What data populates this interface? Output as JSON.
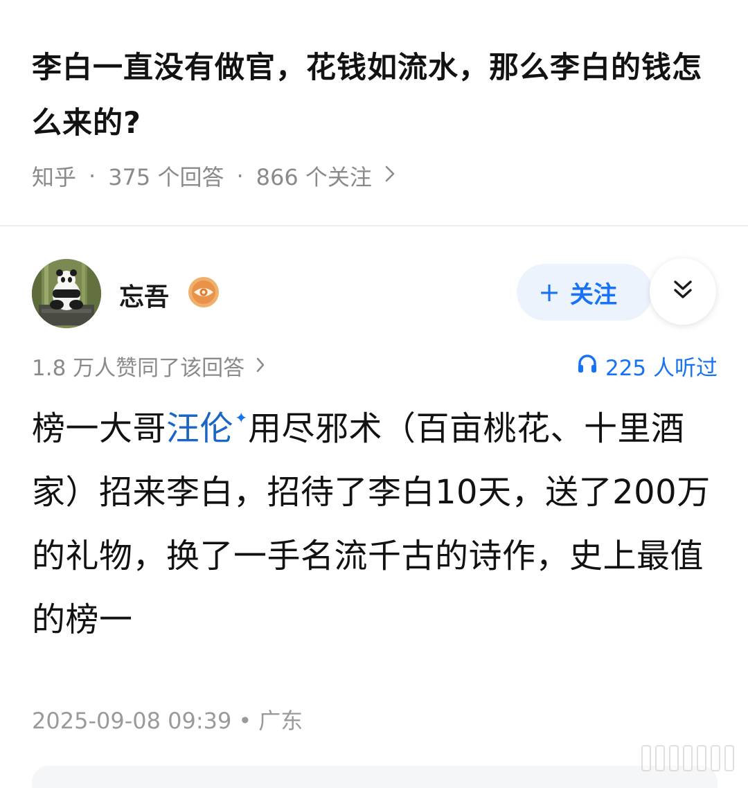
{
  "question": {
    "title": "李白一直没有做官，花钱如流水，那么李白的钱怎么来的?",
    "source": "知乎",
    "answers_count": "375 个回答",
    "followers_count": "866 个关注"
  },
  "author": {
    "name": "忘吾",
    "follow_label": "关注"
  },
  "stats": {
    "upvotes": "1.8 万人赞同了该回答",
    "listeners": "225 人听过"
  },
  "answer": {
    "part1": "榜一大哥",
    "link_text": "汪伦",
    "part2": "用尽邪术（百亩桃花、十里酒家）招来李白，招待了李白10天，送了200万的礼物，换了一手名流千古的诗作，史上最值的榜一"
  },
  "footer": {
    "date": "2025-09-08 09:39",
    "location": "广东"
  },
  "colors": {
    "accent": "#1772f6",
    "meta_gray": "#8a8a8a",
    "follow_bg": "#edf3fd"
  },
  "icons": {
    "badge": "eye-badge-icon",
    "more": "double-chevron-down-icon",
    "listen": "headphones-icon"
  }
}
